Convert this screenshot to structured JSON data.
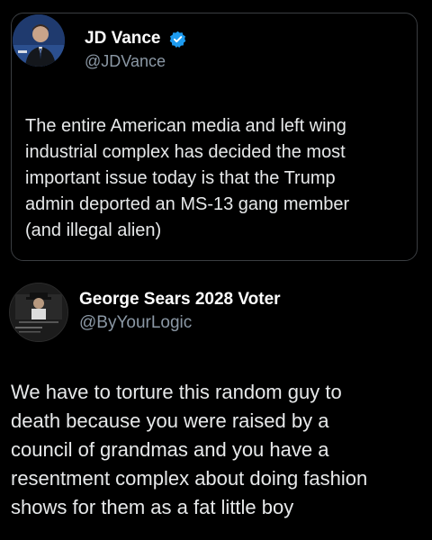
{
  "quoted_tweet": {
    "author_name": "JD Vance",
    "handle": "@JDVance",
    "verified": true,
    "text": "The entire American media and left wing\nindustrial complex has decided the most\nimportant issue today is that the Trump\nadmin deported an MS-13 gang member\n(and illegal alien)"
  },
  "reply_tweet": {
    "author_name": "George Sears 2028 Voter",
    "handle": "@ByYourLogic",
    "text": "We have to torture this random guy to\ndeath because you were raised by a\ncouncil of grandmas and you have a\nresentment complex about doing fashion\nshows for them as a fat little boy"
  },
  "colors": {
    "background": "#000000",
    "primary_text": "#e7e9ea",
    "secondary_text": "#8b98a5",
    "verified_badge": "#1d9bf0",
    "card_border": "#3a3d41"
  }
}
